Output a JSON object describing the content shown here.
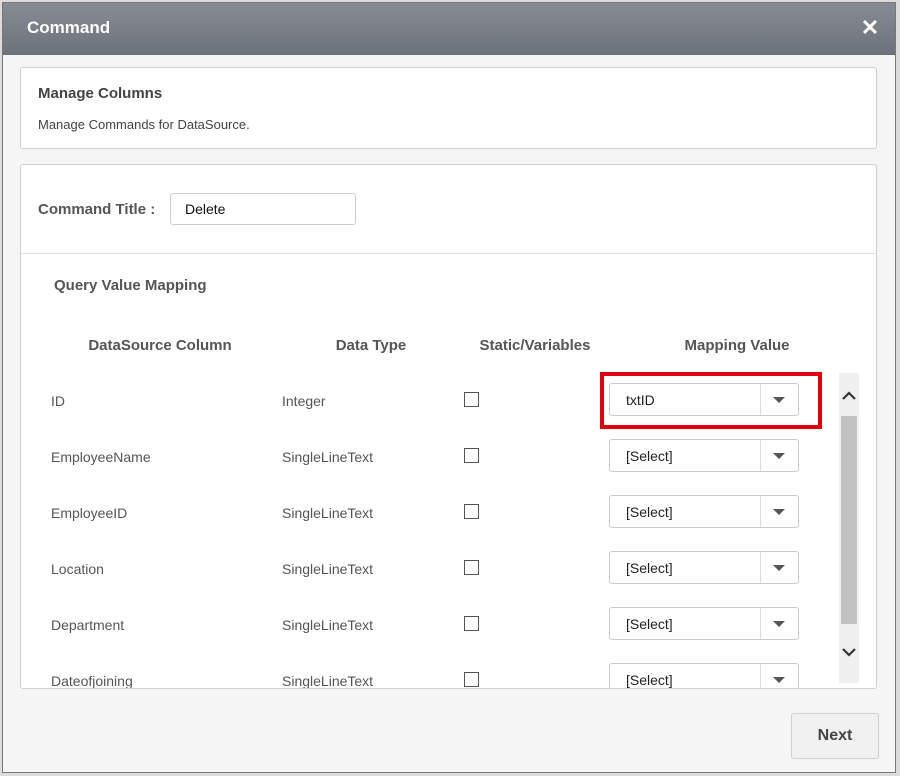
{
  "dialog": {
    "title": "Command",
    "close_icon": "close-icon"
  },
  "manage": {
    "heading": "Manage Columns",
    "subheading": "Manage Commands for DataSource."
  },
  "command": {
    "label": "Command Title :",
    "value": "Delete"
  },
  "mapping": {
    "heading": "Query Value Mapping",
    "headers": [
      "DataSource Column",
      "Data Type",
      "Static/Variables",
      "Mapping Value"
    ],
    "rows": [
      {
        "column": "ID",
        "type": "Integer",
        "mapping": "txtID",
        "static": false
      },
      {
        "column": "EmployeeName",
        "type": "SingleLineText",
        "mapping": "[Select]",
        "static": false
      },
      {
        "column": "EmployeeID",
        "type": "SingleLineText",
        "mapping": "[Select]",
        "static": false
      },
      {
        "column": "Location",
        "type": "SingleLineText",
        "mapping": "[Select]",
        "static": false
      },
      {
        "column": "Department",
        "type": "SingleLineText",
        "mapping": "[Select]",
        "static": false
      },
      {
        "column": "Dateofjoining",
        "type": "SingleLineText",
        "mapping": "[Select]",
        "static": false
      }
    ]
  },
  "footer": {
    "next_label": "Next"
  },
  "colors": {
    "highlight": "#e2000f",
    "titlebar": "#6c727a"
  }
}
